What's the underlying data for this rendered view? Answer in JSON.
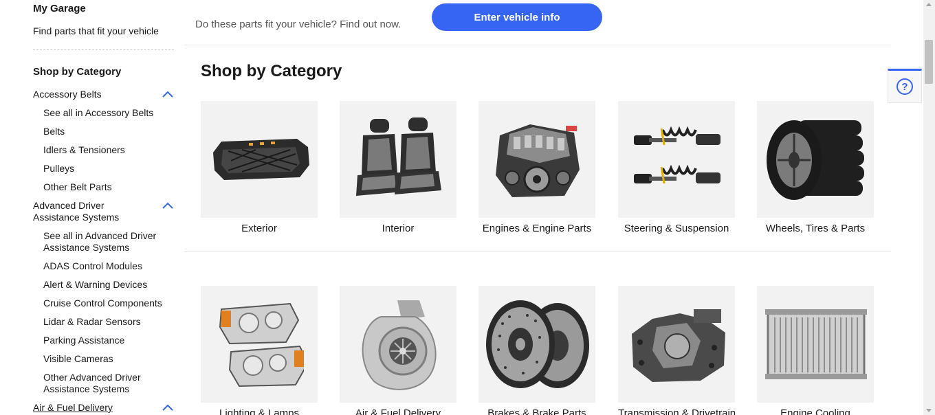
{
  "sidebar": {
    "garage_title": "My Garage",
    "garage_link": "Find parts that fit your vehicle",
    "shop_title": "Shop by Category",
    "categories": [
      {
        "label": "Accessory Belts",
        "expanded": true,
        "items": [
          "See all in Accessory Belts",
          "Belts",
          "Idlers & Tensioners",
          "Pulleys",
          "Other Belt Parts"
        ]
      },
      {
        "label": "Advanced Driver Assistance Systems",
        "expanded": true,
        "items": [
          "See all in Advanced Driver Assistance Systems",
          "ADAS Control Modules",
          "Alert & Warning Devices",
          "Cruise Control Components",
          "Lidar & Radar Sensors",
          "Parking Assistance",
          "Visible Cameras",
          "Other Advanced Driver Assistance Systems"
        ]
      },
      {
        "label": "Air & Fuel Delivery",
        "expanded": true,
        "items": []
      }
    ]
  },
  "fitment": {
    "prompt": "Do these parts fit your vehicle? Find out now.",
    "button": "Enter vehicle info"
  },
  "main": {
    "section_title": "Shop by Category",
    "tiles": [
      {
        "label": "Exterior",
        "icon": "grille-image"
      },
      {
        "label": "Interior",
        "icon": "seat-covers-image"
      },
      {
        "label": "Engines & Engine Parts",
        "icon": "engine-image"
      },
      {
        "label": "Steering & Suspension",
        "icon": "struts-image"
      },
      {
        "label": "Wheels, Tires & Parts",
        "icon": "tires-image"
      },
      {
        "label": "Lighting & Lamps",
        "icon": "headlights-image"
      },
      {
        "label": "Air & Fuel Delivery",
        "icon": "turbo-image"
      },
      {
        "label": "Brakes & Brake Parts",
        "icon": "rotors-image"
      },
      {
        "label": "Transmission & Drivetrain",
        "icon": "transmission-image"
      },
      {
        "label": "Engine Cooling",
        "icon": "radiator-image"
      }
    ]
  },
  "help": {
    "icon": "help-icon",
    "symbol": "?"
  },
  "colors": {
    "accent": "#3665f3",
    "tile_bg": "#f2f2f2",
    "text": "#191919",
    "muted": "#555555"
  }
}
